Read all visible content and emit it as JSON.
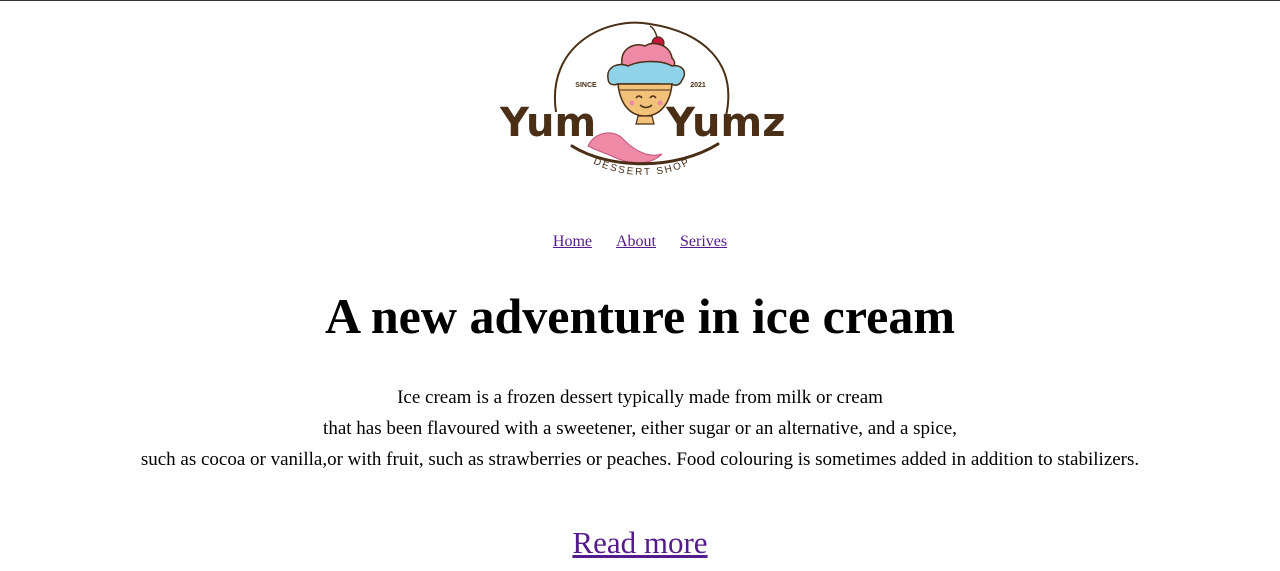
{
  "logo": {
    "brand": "Yum Yumz",
    "brand_left": "Yum",
    "brand_right": "Yumz",
    "tagline": "DESSERT SHOP",
    "since_label": "SINCE",
    "year": "2021",
    "colors": {
      "brown": "#4a2e16",
      "pink": "#ee8aa6",
      "blue": "#8fd3e8",
      "cone": "#f2c27a",
      "cherry": "#c8163a"
    }
  },
  "nav": {
    "items": [
      {
        "label": "Home"
      },
      {
        "label": "About"
      },
      {
        "label": "Serives"
      }
    ]
  },
  "main": {
    "headline": "A new adventure in ice cream",
    "intro_lines": [
      "Ice cream is a frozen dessert typically made from milk or cream",
      "that has been flavoured with a sweetener, either sugar or an alternative, and a spice,",
      "such as cocoa or vanilla,or with fruit, such as strawberries or peaches. Food colouring is sometimes added in addition to stabilizers."
    ],
    "read_more": "Read more"
  },
  "theme": {
    "link_color": "#551a8b",
    "text_color": "#000000",
    "background": "#ffffff"
  }
}
